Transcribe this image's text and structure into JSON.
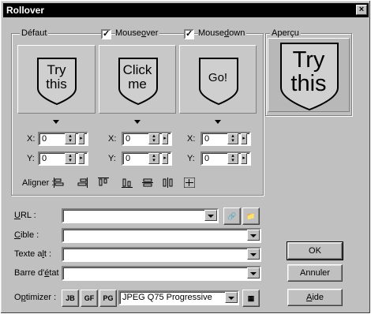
{
  "window": {
    "title": "Rollover",
    "close_glyph": "×"
  },
  "states": {
    "default_label": "Défaut",
    "mouseover_label": "Mouseover",
    "mousedown_label": "Mousedown",
    "mouseover_checked": true,
    "mousedown_checked": true
  },
  "thumbs": [
    {
      "line1": "Try",
      "line2": "this"
    },
    {
      "line1": "Click",
      "line2": "me"
    },
    {
      "line1": "Go!",
      "line2": ""
    }
  ],
  "coords": {
    "x_label": "X:",
    "y_label": "Y:",
    "values": [
      {
        "x": "0",
        "y": "0"
      },
      {
        "x": "0",
        "y": "0"
      },
      {
        "x": "0",
        "y": "0"
      }
    ]
  },
  "align_label": "Aligner :",
  "preview": {
    "label": "Aperçu",
    "line1": "Try",
    "line2": "this"
  },
  "form": {
    "url_label": "URL :",
    "target_label": "Cible :",
    "alt_label": "Texte alt :",
    "status_label": "Barre d'état :",
    "optimize_label": "Optimizer :",
    "url_value": "",
    "target_value": "",
    "alt_value": "",
    "status_value": "",
    "optimize_value": "JPEG Q75 Progressive"
  },
  "buttons": {
    "ok": "OK",
    "cancel": "Annuler",
    "help": "Aide"
  },
  "colors": {
    "title_bg": "#000000",
    "face": "#c0c0c0",
    "shield_fill": "#d0d0d0"
  }
}
